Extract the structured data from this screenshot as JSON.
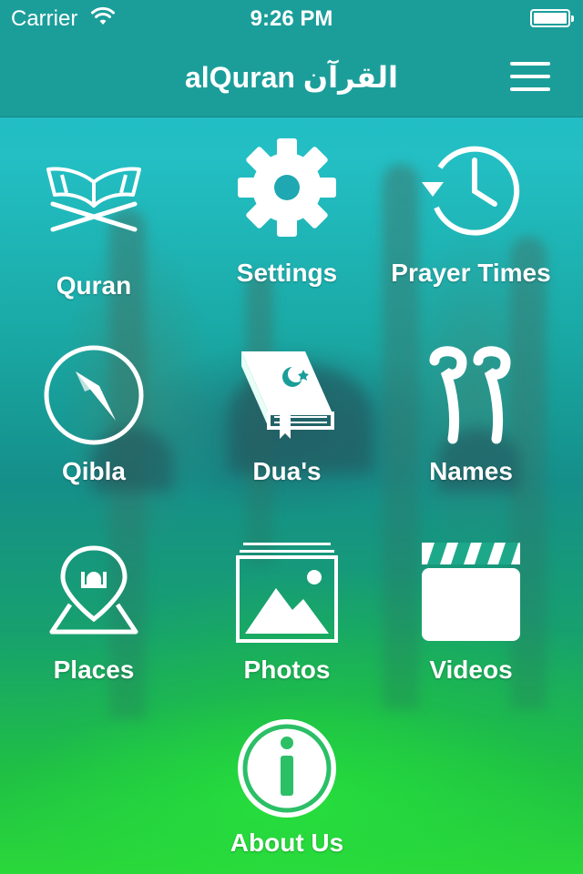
{
  "status_bar": {
    "carrier": "Carrier",
    "time": "9:26 PM"
  },
  "nav": {
    "title": "alQuran القرآن",
    "menu_icon": "hamburger-menu-icon"
  },
  "menu": {
    "items": [
      {
        "label": "Quran",
        "icon": "open-quran-on-stand-icon"
      },
      {
        "label": "Settings",
        "icon": "gear-icon"
      },
      {
        "label": "Prayer Times",
        "icon": "clock-history-icon"
      },
      {
        "label": "Qibla",
        "icon": "compass-icon"
      },
      {
        "label": "Dua's",
        "icon": "book-crescent-icon"
      },
      {
        "label": "Names",
        "icon": "arabic-99-icon"
      },
      {
        "label": "Places",
        "icon": "map-pin-mosque-icon"
      },
      {
        "label": "Photos",
        "icon": "photo-stack-icon"
      },
      {
        "label": "Videos",
        "icon": "clapperboard-icon"
      },
      {
        "label": "About Us",
        "icon": "info-circle-icon"
      }
    ]
  },
  "colors": {
    "bar": "#1b9e9a",
    "icon": "#ffffff"
  }
}
